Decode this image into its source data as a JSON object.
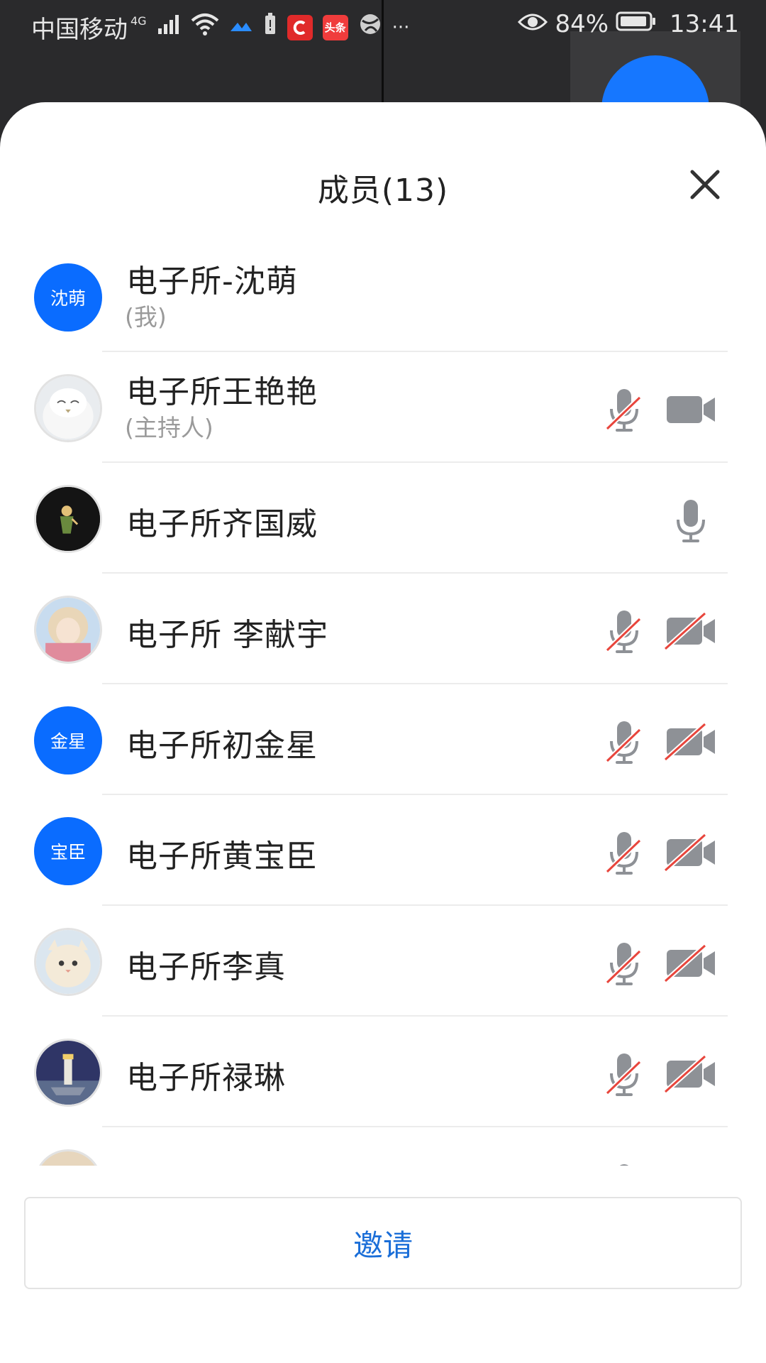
{
  "status_bar": {
    "carrier": "中国移动",
    "network": "4G",
    "battery_percent": "84%",
    "time": "13:41",
    "app_icons": [
      "wifi-icon",
      "cloud-app-icon",
      "battery-saver-icon",
      "c-app-icon",
      "toutiao-app-icon",
      "globe-app-icon"
    ],
    "more": "···",
    "toutiao_label": "头条"
  },
  "sheet": {
    "title": "成员(13)"
  },
  "members": [
    {
      "name": "电子所-沈萌",
      "role": "(我)",
      "avatar_text": "沈萌",
      "avatar": "blue",
      "mic": "none",
      "cam": "none"
    },
    {
      "name": "电子所王艳艳",
      "role": "(主持人)",
      "avatar": "owl-photo",
      "mic": "muted",
      "cam": "on"
    },
    {
      "name": "电子所齐国威",
      "avatar": "prince-photo",
      "mic": "on",
      "cam": "none"
    },
    {
      "name": "电子所 李献宇",
      "avatar": "girl-photo",
      "mic": "muted",
      "cam": "off"
    },
    {
      "name": "电子所初金星",
      "avatar_text": "金星",
      "avatar": "blue",
      "mic": "muted",
      "cam": "off"
    },
    {
      "name": "电子所黄宝臣",
      "avatar_text": "宝臣",
      "avatar": "blue",
      "mic": "muted",
      "cam": "off"
    },
    {
      "name": "电子所李真",
      "avatar": "cat-photo",
      "mic": "muted",
      "cam": "off"
    },
    {
      "name": "电子所禄琳",
      "avatar": "lighthouse-photo",
      "mic": "muted",
      "cam": "off"
    }
  ],
  "invite_label": "邀请",
  "colors": {
    "accent": "#0a6cff",
    "invite_text": "#1a6ed8",
    "icon_gray": "#8e9196",
    "muted_slash": "#e8453c"
  }
}
